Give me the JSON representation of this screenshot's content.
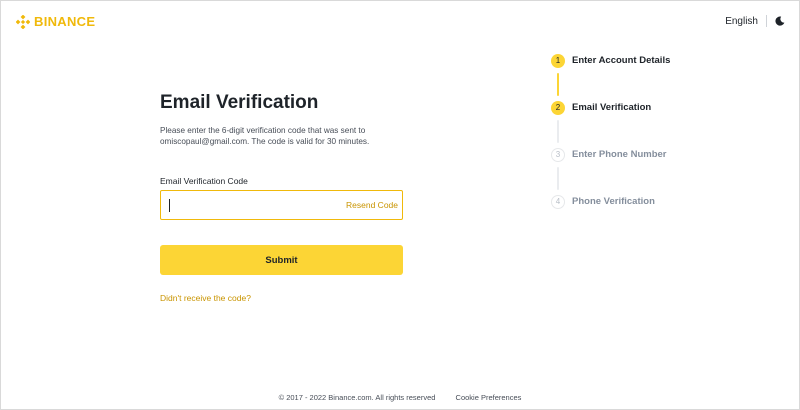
{
  "header": {
    "logo_text": "BINANCE",
    "language": "English",
    "theme_icon": "moon-icon"
  },
  "form": {
    "title": "Email Verification",
    "description": "Please enter the 6-digit verification code that was sent to omiscopaul@gmail.com. The code is valid for 30 minutes.",
    "field_label": "Email Verification Code",
    "input_value": "",
    "resend_label": "Resend Code",
    "submit_label": "Submit",
    "no_code_link": "Didn't receive the code?"
  },
  "stepper": {
    "steps": [
      {
        "number": "1",
        "label": "Enter Account Details",
        "state": "active"
      },
      {
        "number": "2",
        "label": "Email Verification",
        "state": "active"
      },
      {
        "number": "3",
        "label": "Enter Phone Number",
        "state": "inactive"
      },
      {
        "number": "4",
        "label": "Phone Verification",
        "state": "inactive"
      }
    ]
  },
  "footer": {
    "copyright": "© 2017 - 2022 Binance.com. All rights reserved",
    "cookie_link": "Cookie Preferences"
  },
  "colors": {
    "brand_yellow": "#fcd535",
    "brand_gold": "#f0b90b",
    "link_gold": "#c99400",
    "text_primary": "#1e2329",
    "text_muted": "#848e9c"
  }
}
